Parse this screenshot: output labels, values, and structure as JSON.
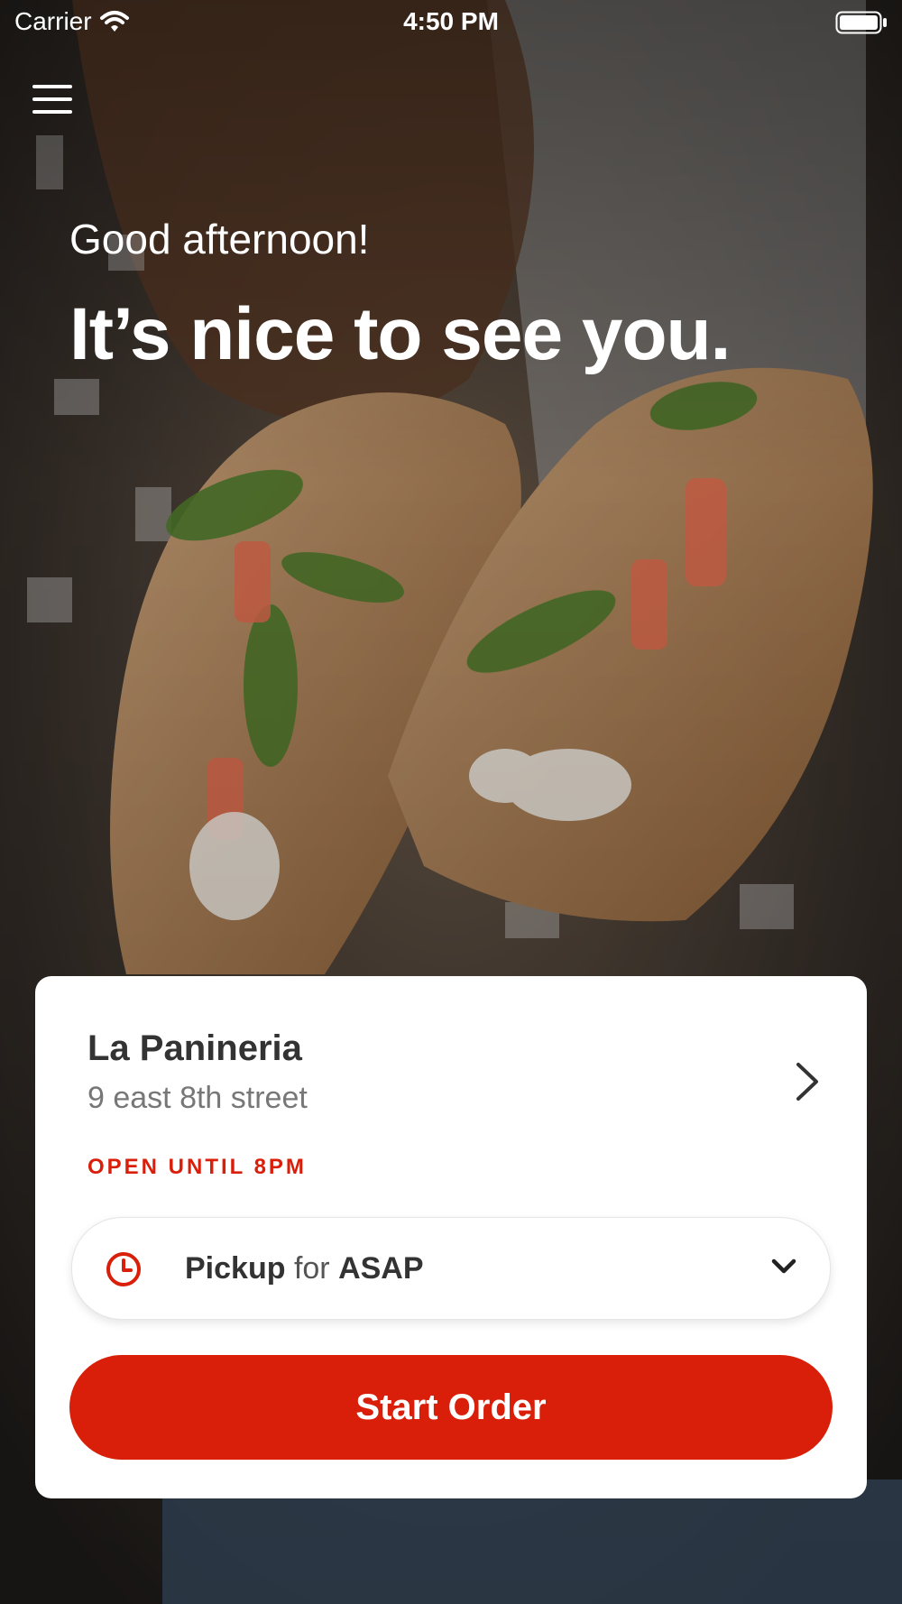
{
  "status_bar": {
    "carrier": "Carrier",
    "time": "4:50 PM"
  },
  "hero": {
    "greeting": "Good afternoon!",
    "headline": "It’s nice to see you."
  },
  "location_card": {
    "store_name": "La Panineria",
    "address": "9 east 8th street",
    "open_status": "OPEN UNTIL 8PM",
    "order_type": {
      "mode": "Pickup",
      "connector": "for",
      "time": "ASAP"
    },
    "start_order_label": "Start Order"
  },
  "colors": {
    "accent": "#d91f0a",
    "card_bg": "#ffffff",
    "text_dark": "#333333"
  },
  "icons": [
    "wifi-icon",
    "battery-icon",
    "menu-icon",
    "chevron-right-icon",
    "clock-icon",
    "chevron-down-icon"
  ]
}
